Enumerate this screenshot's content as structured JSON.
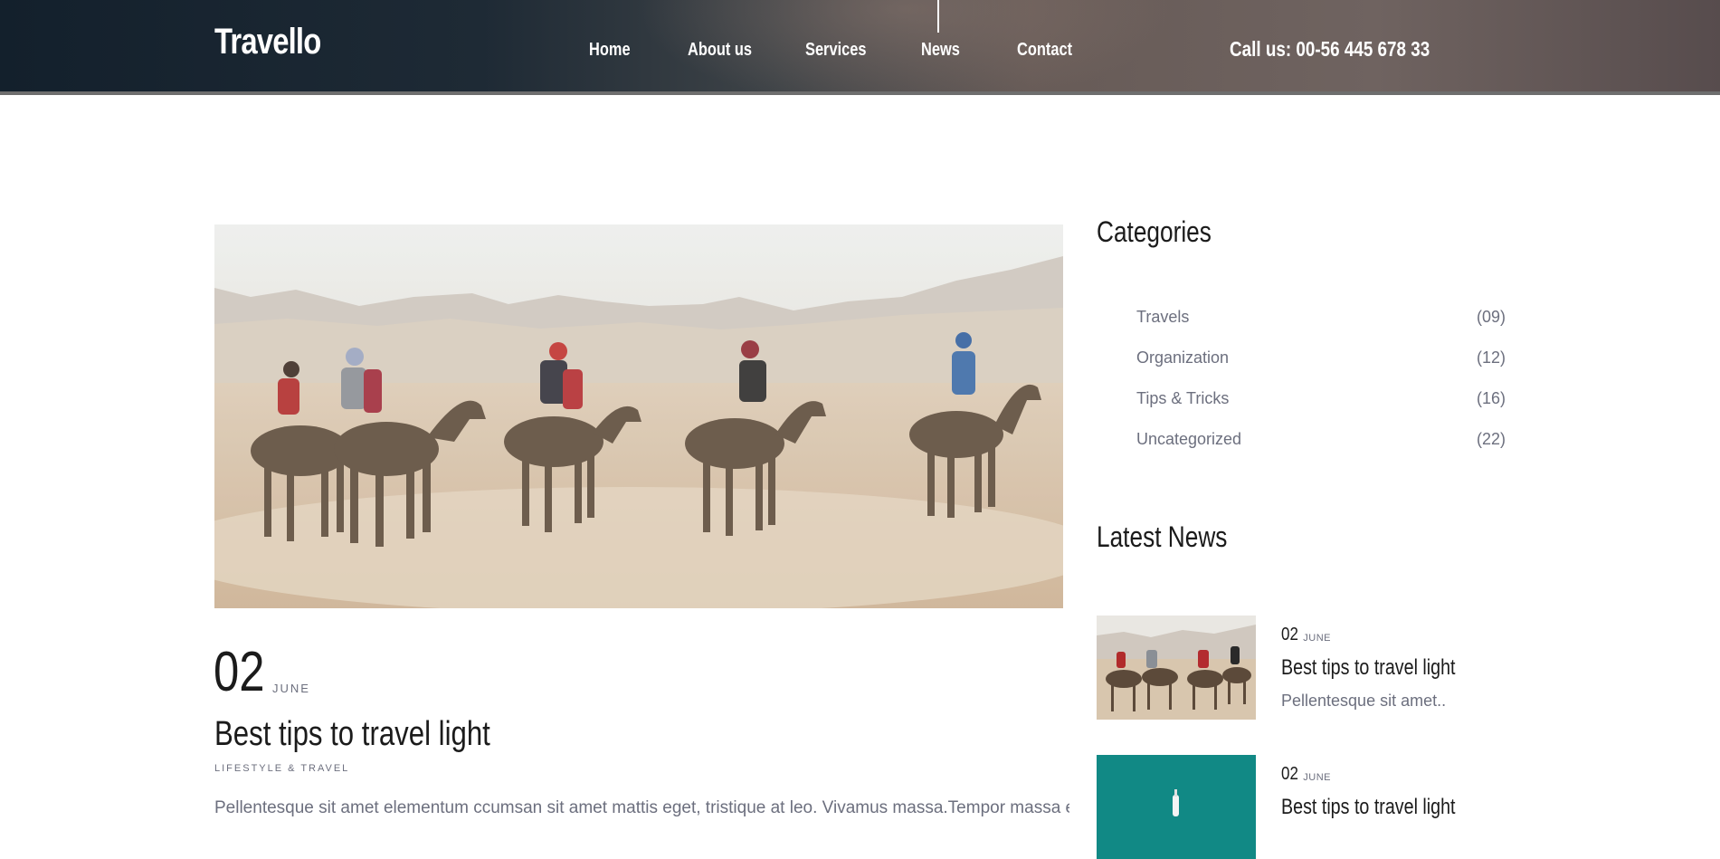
{
  "header": {
    "logo": "Travello",
    "nav": [
      {
        "label": "Home"
      },
      {
        "label": "About us"
      },
      {
        "label": "Services"
      },
      {
        "label": "News"
      },
      {
        "label": "Contact"
      }
    ],
    "phone": "Call us: 00-56 445 678 33"
  },
  "post": {
    "day": "02",
    "month": "JUNE",
    "title": "Best tips to travel light",
    "meta": "LIFESTYLE & TRAVEL",
    "excerpt": "Pellentesque sit amet elementum ccumsan sit amet mattis eget, tristique at leo. Vivamus massa.Tempor massa et"
  },
  "sidebar": {
    "categories_heading": "Categories",
    "categories": [
      {
        "name": "Travels",
        "count": "(09)"
      },
      {
        "name": "Organization",
        "count": "(12)"
      },
      {
        "name": "Tips & Tricks",
        "count": "(16)"
      },
      {
        "name": "Uncategorized",
        "count": "(22)"
      }
    ],
    "latest_heading": "Latest News",
    "latest": [
      {
        "day": "02",
        "month": "JUNE",
        "title": "Best tips to travel light",
        "excerpt": "Pellentesque sit amet..",
        "thumb": "camel-caravan-image"
      },
      {
        "day": "02",
        "month": "JUNE",
        "title": "Best tips to travel light",
        "excerpt": "",
        "thumb": "teal-water-boat-image"
      }
    ]
  },
  "colors": {
    "text_dark": "#1b1b1b",
    "text_muted": "#6c6f7e",
    "header_border": "#6e6e6e",
    "teal": "#138f8a"
  }
}
